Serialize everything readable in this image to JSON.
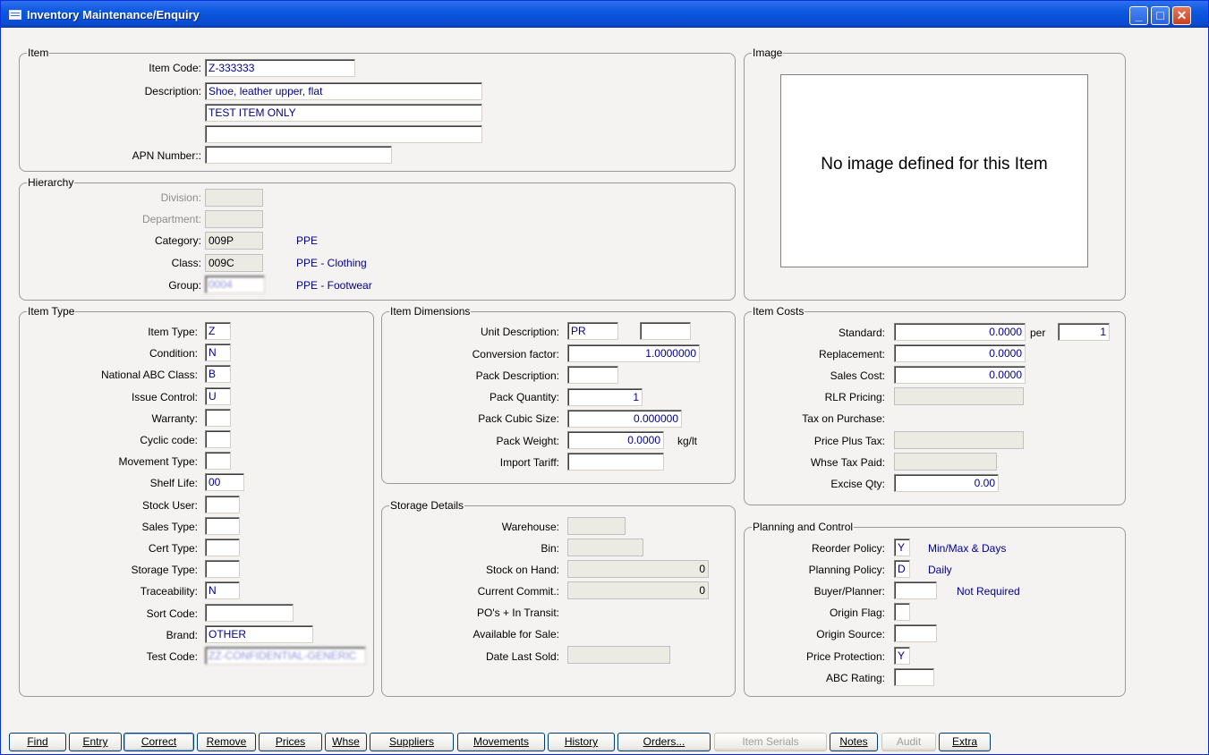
{
  "window": {
    "title": "Inventory Maintenance/Enquiry"
  },
  "item": {
    "legend": "Item",
    "code_label": "Item Code:",
    "code": "Z-333333",
    "desc_label": "Description:",
    "desc1": "Shoe, leather upper, flat",
    "desc2": "TEST ITEM ONLY",
    "desc3": "",
    "apn_label": "APN Number::",
    "apn": ""
  },
  "image": {
    "legend": "Image",
    "message": "No image defined for this Item"
  },
  "hierarchy": {
    "legend": "Hierarchy",
    "division_label": "Division:",
    "division": "",
    "department_label": "Department:",
    "department": "",
    "category_label": "Category:",
    "category": "009P",
    "category_desc": "PPE",
    "class_label": "Class:",
    "class": "009C",
    "class_desc": "PPE - Clothing",
    "group_label": "Group:",
    "group": "0004",
    "group_desc": "PPE - Footwear"
  },
  "item_type": {
    "legend": "Item Type",
    "rows": [
      {
        "label": "Item Type:",
        "value": "Z"
      },
      {
        "label": "Condition:",
        "value": "N"
      },
      {
        "label": "National ABC Class:",
        "value": "B"
      },
      {
        "label": "Issue Control:",
        "value": "U"
      },
      {
        "label": "Warranty:",
        "value": ""
      },
      {
        "label": "Cyclic code:",
        "value": ""
      },
      {
        "label": "Movement Type:",
        "value": ""
      },
      {
        "label": "Shelf Life:",
        "value": "00"
      },
      {
        "label": "Stock User:",
        "value": ""
      },
      {
        "label": "Sales Type:",
        "value": ""
      },
      {
        "label": "Cert Type:",
        "value": ""
      },
      {
        "label": "Storage Type:",
        "value": ""
      },
      {
        "label": "Traceability:",
        "value": "N"
      },
      {
        "label": "Sort Code:",
        "value": ""
      },
      {
        "label": "Brand:",
        "value": "OTHER"
      },
      {
        "label": "Test Code:",
        "value": "ZZ-CONFIDENTIAL-GENERIC"
      }
    ]
  },
  "dimensions": {
    "legend": "Item Dimensions",
    "unit_label": "Unit Description:",
    "unit": "PR",
    "unit2": "",
    "conv_label": "Conversion factor:",
    "conv": "1.0000000",
    "packdesc_label": "Pack Description:",
    "packdesc": "",
    "packqty_label": "Pack Quantity:",
    "packqty": "1",
    "cubic_label": "Pack Cubic Size:",
    "cubic": "0.000000",
    "weight_label": "Pack Weight:",
    "weight": "0.0000",
    "weight_unit": "kg/lt",
    "tariff_label": "Import Tariff:",
    "tariff": ""
  },
  "storage": {
    "legend": "Storage Details",
    "warehouse_label": "Warehouse:",
    "warehouse": "",
    "bin_label": "Bin:",
    "bin": "",
    "soh_label": "Stock on Hand:",
    "soh": "0",
    "commit_label": "Current Commit.:",
    "commit": "0",
    "po_label": "PO's + In Transit:",
    "avail_label": "Available for Sale:",
    "lastsold_label": "Date Last Sold:",
    "lastsold": ""
  },
  "costs": {
    "legend": "Item Costs",
    "standard_label": "Standard:",
    "standard": "0.0000",
    "per_label": "per",
    "per": "1",
    "replacement_label": "Replacement:",
    "replacement": "0.0000",
    "sales_label": "Sales Cost:",
    "sales": "0.0000",
    "rlr_label": "RLR Pricing:",
    "rlr": "",
    "tax_purchase_label": "Tax on Purchase:",
    "price_plus_tax_label": "Price Plus Tax:",
    "price_plus_tax": "",
    "whse_tax_label": "Whse Tax Paid:",
    "whse_tax": "",
    "excise_label": "Excise Qty:",
    "excise": "0.00"
  },
  "planning": {
    "legend": "Planning and Control",
    "reorder_label": "Reorder Policy:",
    "reorder": "Y",
    "reorder_desc": "Min/Max & Days",
    "planning_label": "Planning Policy:",
    "planning": "D",
    "planning_desc": "Daily",
    "buyer_label": "Buyer/Planner:",
    "buyer": "",
    "buyer_desc": "Not Required",
    "origin_flag_label": "Origin Flag:",
    "origin_flag": "",
    "origin_source_label": "Origin Source:",
    "origin_source": "",
    "price_protect_label": "Price Protection:",
    "price_protect": "Y",
    "abc_label": "ABC Rating:",
    "abc": ""
  },
  "buttons": [
    "Find",
    "Entry",
    "Correct",
    "Remove",
    "Prices",
    "Whse",
    "Suppliers",
    "Movements",
    "History",
    "Orders...",
    "Item Serials",
    "Notes",
    "Audit",
    "Extra"
  ]
}
